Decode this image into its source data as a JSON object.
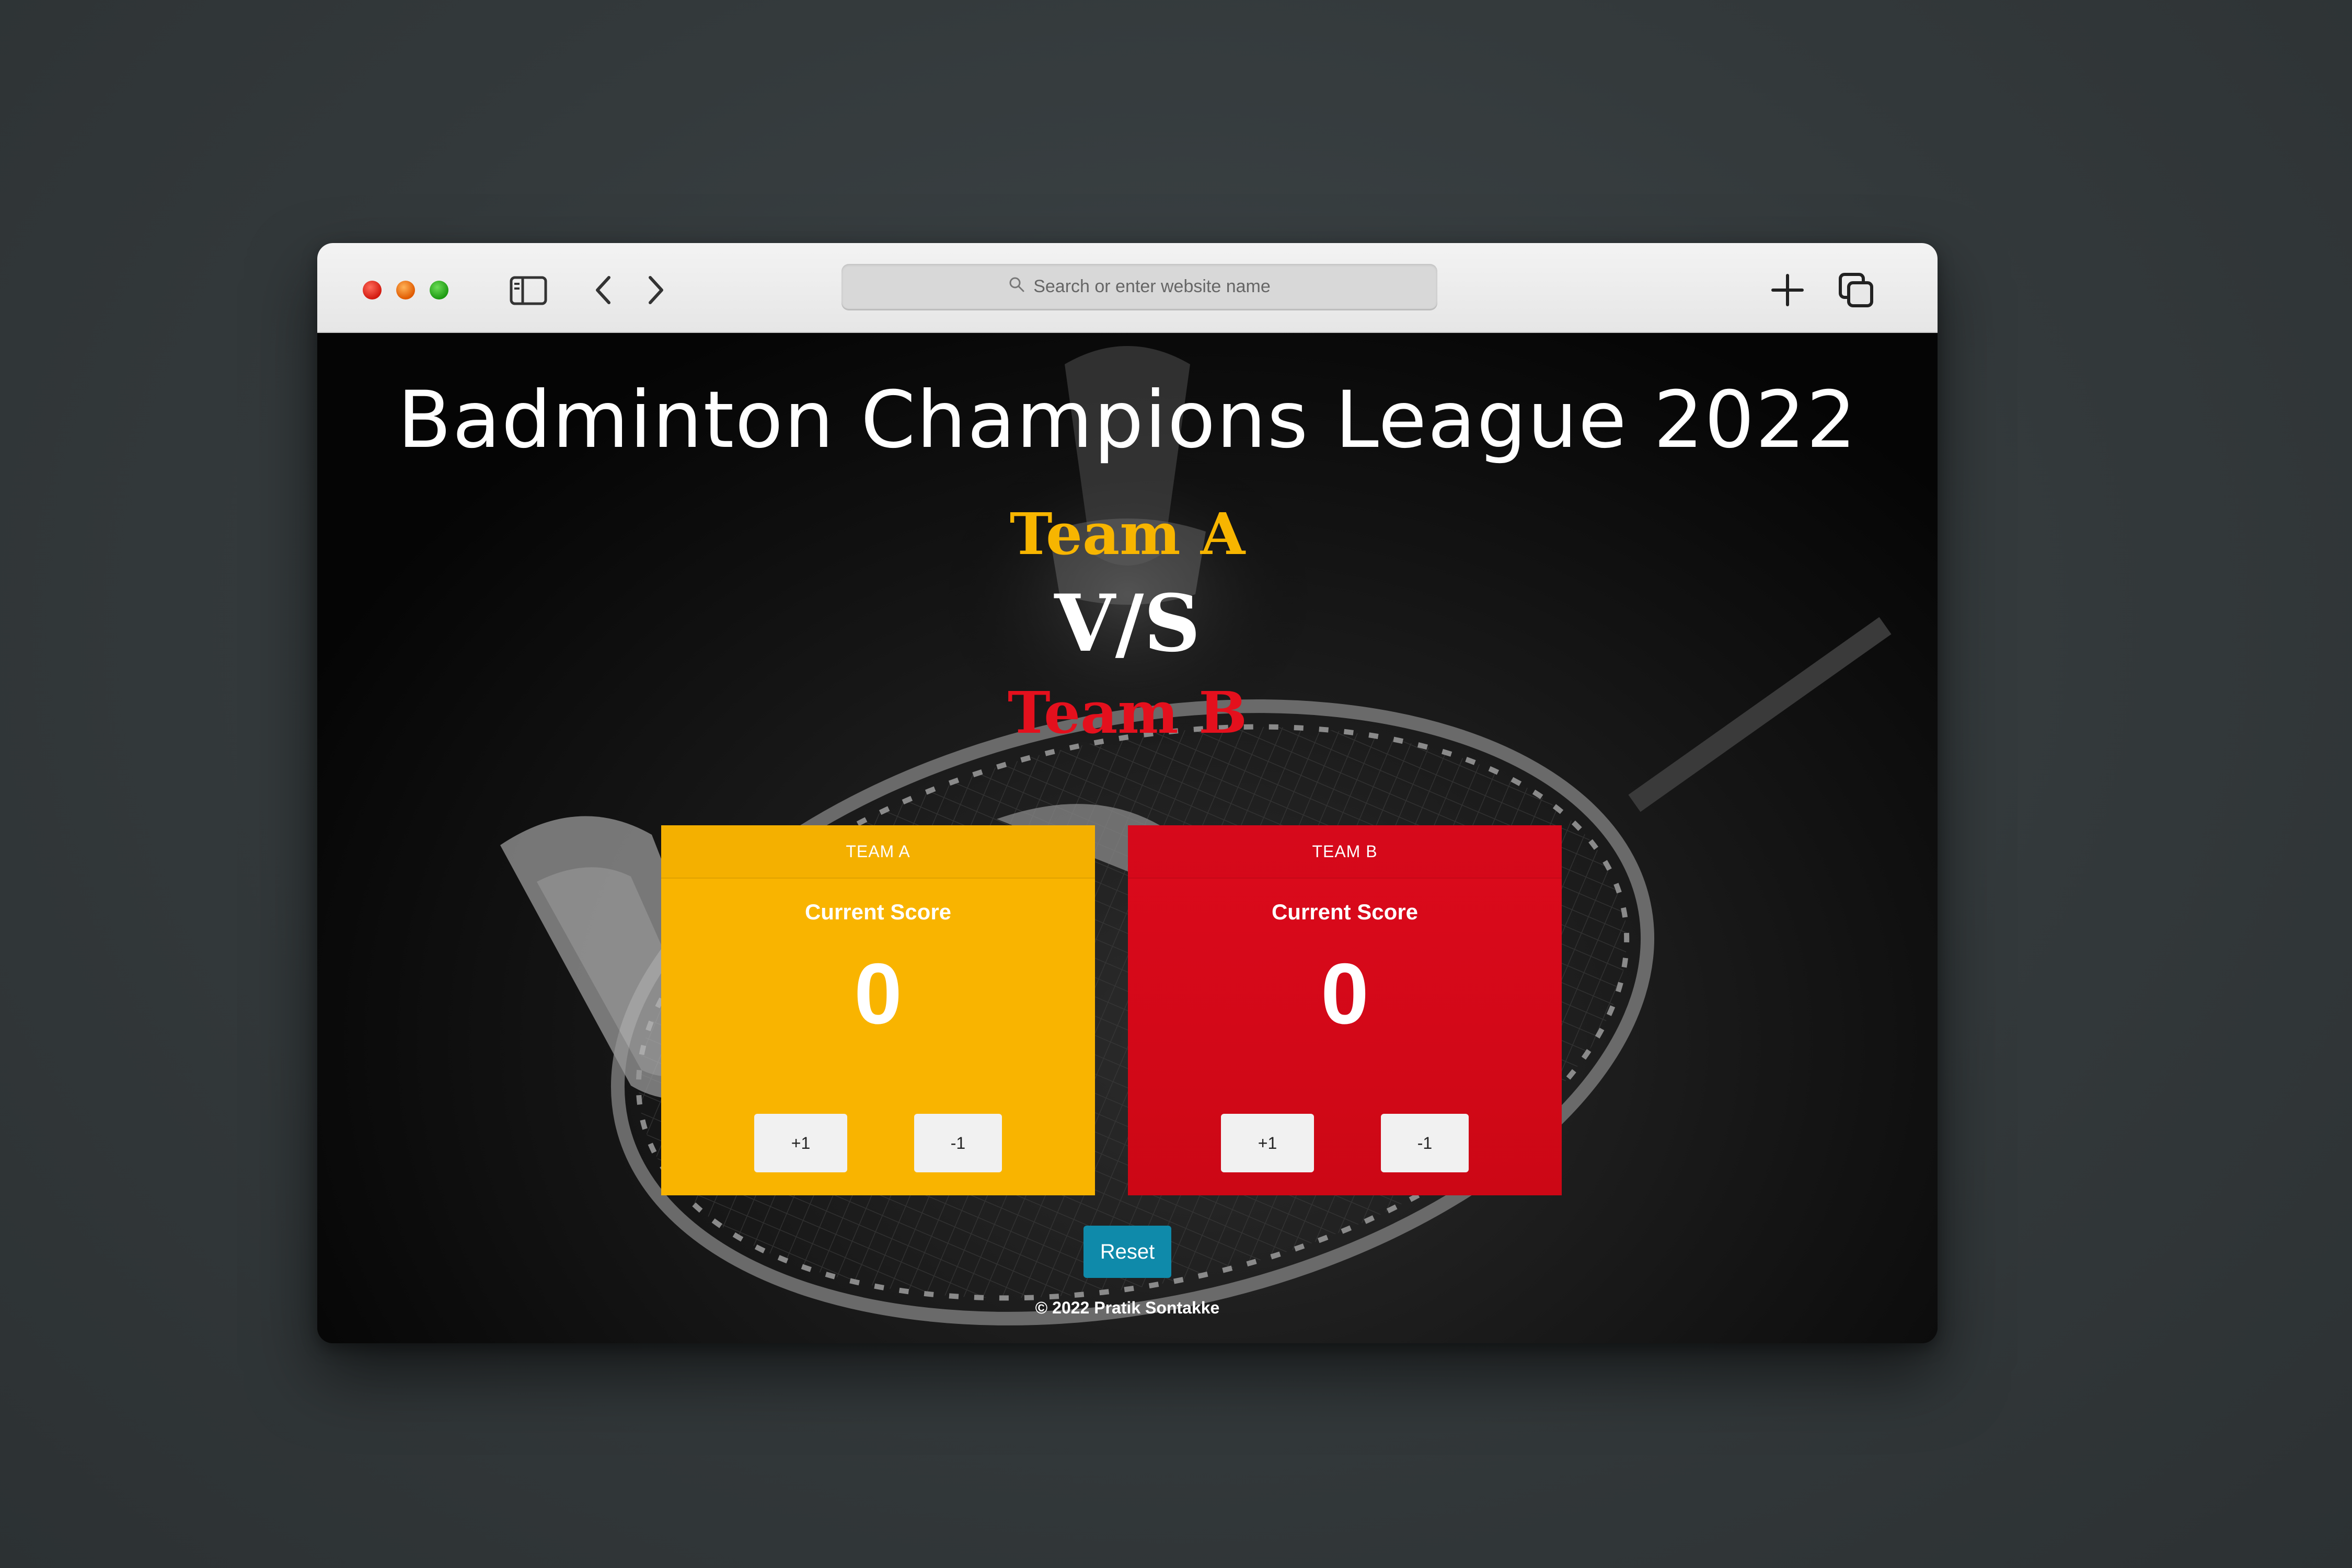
{
  "browser": {
    "address_placeholder": "Search or enter website name",
    "icons": [
      "sidebar-icon",
      "back-icon",
      "forward-icon",
      "new-tab-icon",
      "tabs-overview-icon",
      "search-icon"
    ]
  },
  "page": {
    "title": "Badminton Champions League 2022",
    "team_a_heading": "Team A",
    "versus": "V/S",
    "team_b_heading": "Team B",
    "colors": {
      "team_a": "#f9b400",
      "team_b": "#dc0a1c",
      "reset": "#0f8aaa"
    }
  },
  "cards": {
    "a": {
      "header": "TEAM A",
      "subtitle": "Current Score",
      "score": "0",
      "plus_label": "+1",
      "minus_label": "-1"
    },
    "b": {
      "header": "TEAM B",
      "subtitle": "Current Score",
      "score": "0",
      "plus_label": "+1",
      "minus_label": "-1"
    }
  },
  "reset_label": "Reset",
  "footer": "© 2022 Pratik Sontakke"
}
